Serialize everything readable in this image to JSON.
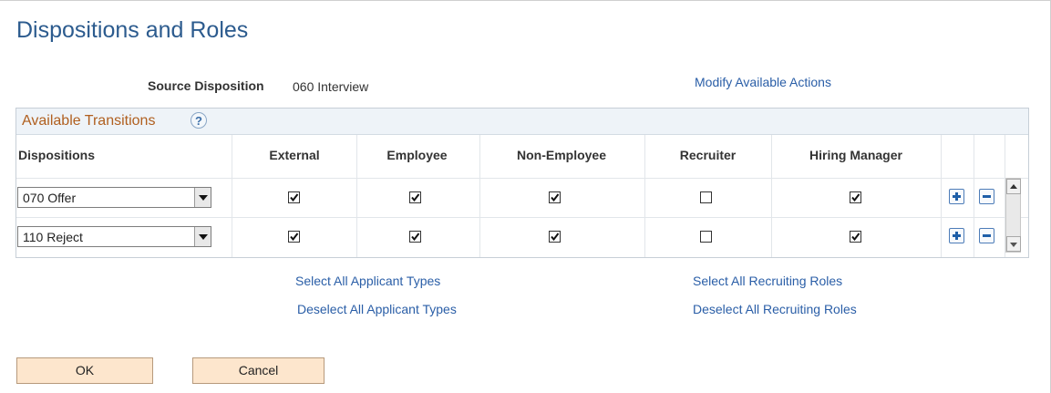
{
  "page": {
    "title": "Dispositions and Roles"
  },
  "source": {
    "label": "Source Disposition",
    "value": "060 Interview"
  },
  "links": {
    "modify_actions": "Modify Available Actions",
    "select_all_applicant": "Select All Applicant Types",
    "deselect_all_applicant": "Deselect All Applicant Types",
    "select_all_recruiting": "Select All Recruiting Roles",
    "deselect_all_recruiting": "Deselect All Recruiting Roles"
  },
  "grid": {
    "title": "Available Transitions",
    "help_icon": "help-icon",
    "help_glyph": "?",
    "columns": [
      "Dispositions",
      "External",
      "Employee",
      "Non-Employee",
      "Recruiter",
      "Hiring Manager"
    ],
    "rows": [
      {
        "disposition": "070 Offer",
        "external": true,
        "employee": true,
        "non_employee": true,
        "recruiter": false,
        "hiring_manager": true
      },
      {
        "disposition": "110 Reject",
        "external": true,
        "employee": true,
        "non_employee": true,
        "recruiter": false,
        "hiring_manager": true
      }
    ],
    "row_actions": {
      "add_icon": "plus-icon",
      "delete_icon": "minus-icon"
    }
  },
  "buttons": {
    "ok": "OK",
    "cancel": "Cancel"
  },
  "colors": {
    "title": "#2c5b8e",
    "link": "#2a5ea7",
    "grid_title": "#b05f1f",
    "button_bg": "#fde6cd"
  }
}
